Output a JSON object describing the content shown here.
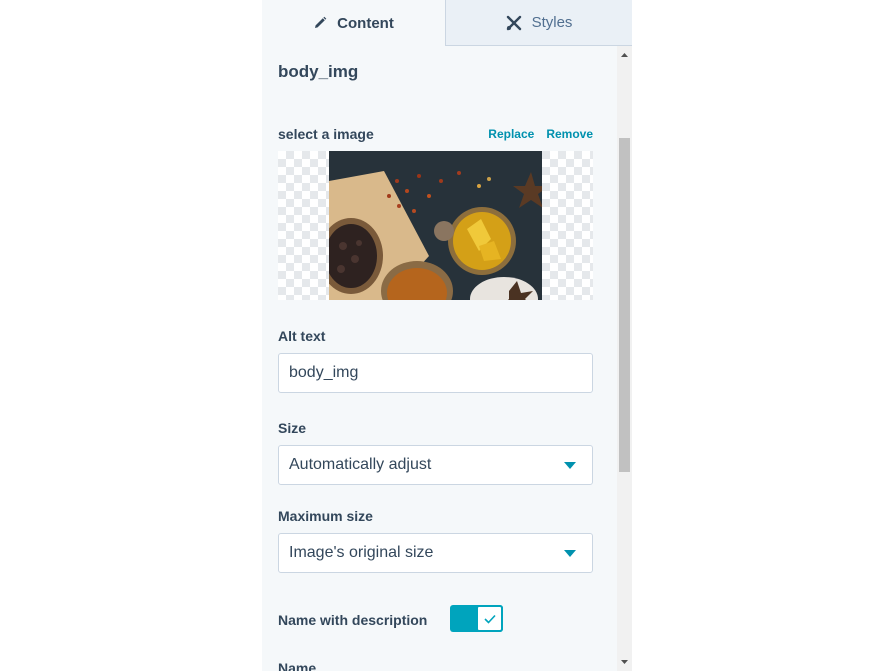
{
  "tabs": {
    "content_label": "Content",
    "styles_label": "Styles",
    "content_icon": "pencil-icon",
    "styles_icon": "brush-tools-icon"
  },
  "module": {
    "title": "body_img"
  },
  "image_field": {
    "label": "select a image",
    "replace_label": "Replace",
    "remove_label": "Remove"
  },
  "alt_text": {
    "label": "Alt text",
    "value": "body_img"
  },
  "size": {
    "label": "Size",
    "selected": "Automatically adjust"
  },
  "max_size": {
    "label": "Maximum size",
    "selected": "Image's original size"
  },
  "name_with_description": {
    "label": "Name with description",
    "enabled": true
  },
  "name_field": {
    "label": "Name"
  },
  "colors": {
    "accent": "#0091ae",
    "toggle": "#00a4bd",
    "text": "#33475b",
    "panel_bg": "#f5f8fa"
  }
}
